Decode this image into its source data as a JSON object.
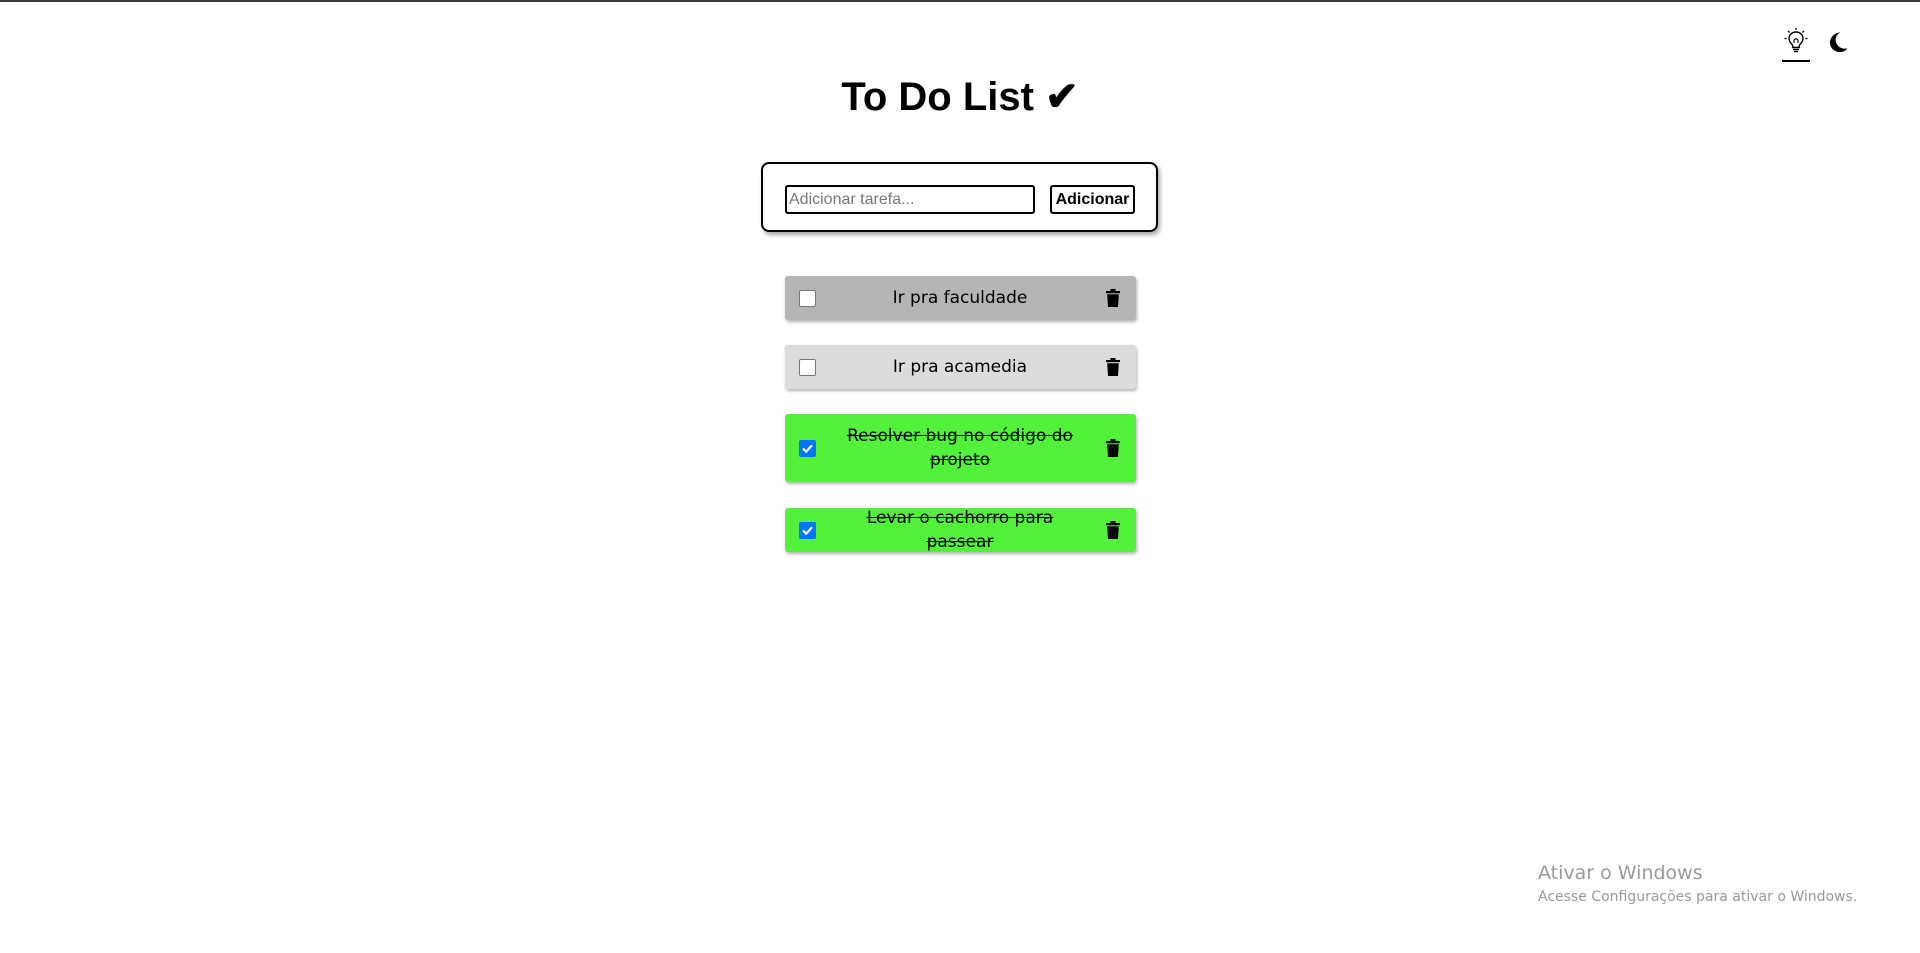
{
  "header": {
    "title": "To Do List ✔"
  },
  "theme": {
    "light_icon": "lightbulb-icon",
    "dark_icon": "moon-icon",
    "active": "light"
  },
  "add_form": {
    "placeholder": "Adicionar tarefa...",
    "value": "",
    "button_label": "Adicionar"
  },
  "tasks": [
    {
      "text": "Ir pra faculdade",
      "done": false,
      "color": "#b5b5b5"
    },
    {
      "text": "Ir pra acamedia",
      "done": false,
      "color": "#dcdcdc"
    },
    {
      "text": "Resolver bug no código do projeto",
      "done": true,
      "color": "#52f23b"
    },
    {
      "text": "Levar o cachorro para passear",
      "done": true,
      "color": "#52f23b"
    }
  ],
  "watermark": {
    "title": "Ativar o Windows",
    "subtitle": "Acesse Configurações para ativar o Windows."
  }
}
